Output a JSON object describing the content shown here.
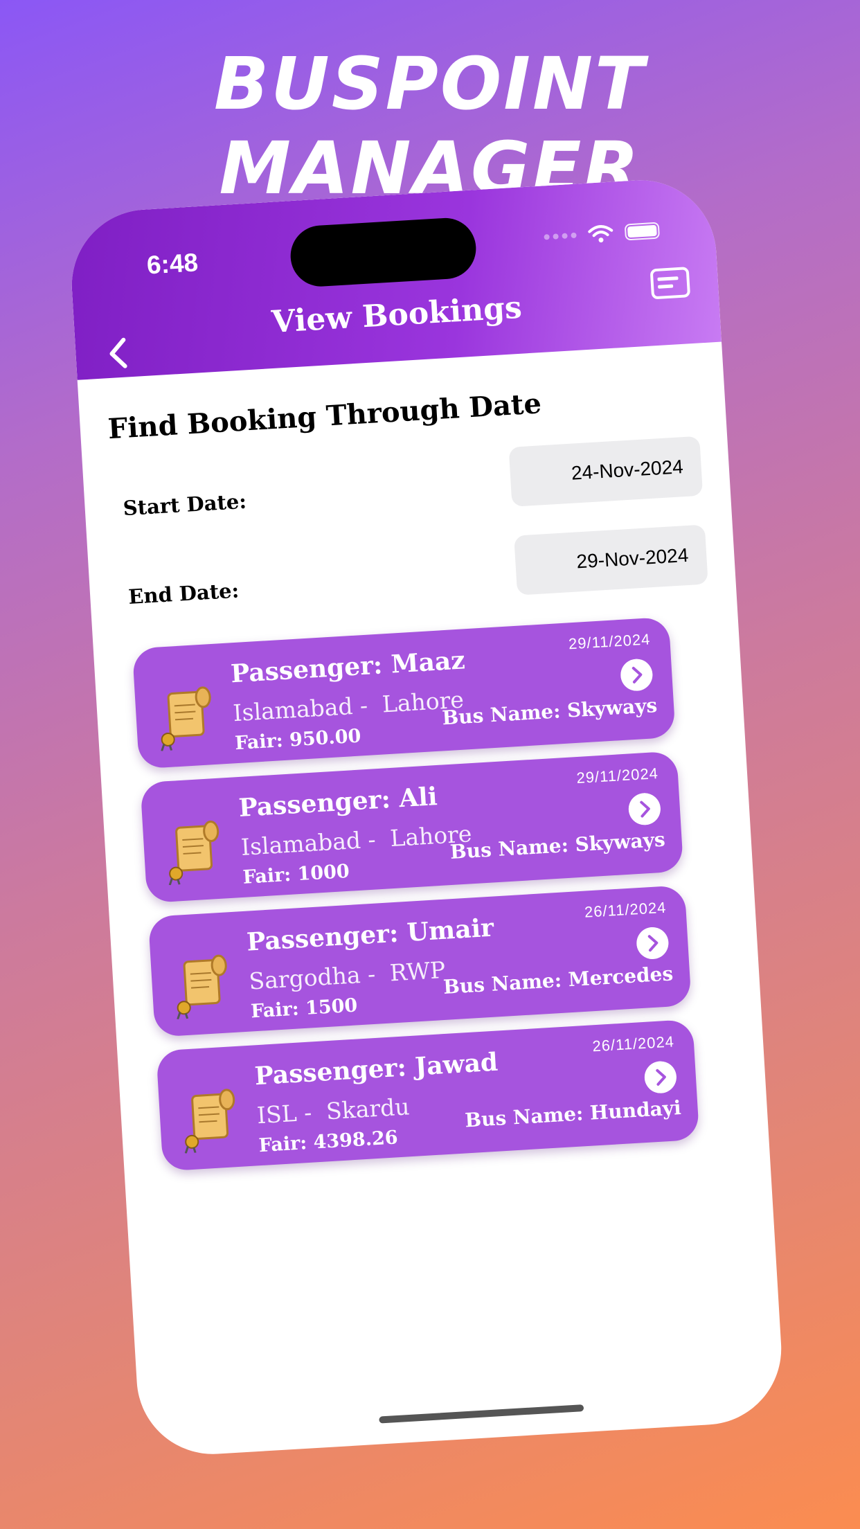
{
  "headline": "BUSPOINT MANAGER",
  "status_bar": {
    "time": "6:48"
  },
  "nav": {
    "title": "View Bookings"
  },
  "filter": {
    "section_title": "Find Booking Through Date",
    "start_label": "Start Date:",
    "start_value": "24-Nov-2024",
    "end_label": "End Date:",
    "end_value": "29-Nov-2024"
  },
  "bookings": [
    {
      "passenger": "Passenger: Maaz",
      "route": "Islamabad -  Lahore",
      "fair": "Fair: 950.00",
      "date": "29/11/2024",
      "bus": "Bus Name: Skyways"
    },
    {
      "passenger": "Passenger: Ali",
      "route": "Islamabad -  Lahore",
      "fair": "Fair: 1000",
      "date": "29/11/2024",
      "bus": "Bus Name: Skyways"
    },
    {
      "passenger": "Passenger: Umair",
      "route": "Sargodha -  RWP",
      "fair": "Fair: 1500",
      "date": "26/11/2024",
      "bus": "Bus Name: Mercedes"
    },
    {
      "passenger": "Passenger: Jawad",
      "route": "ISL -  Skardu",
      "fair": "Fair: 4398.26",
      "date": "26/11/2024",
      "bus": "Bus Name: Hundayi"
    }
  ],
  "colors": {
    "accent": "#a654de",
    "header": "#8a2bd4"
  }
}
